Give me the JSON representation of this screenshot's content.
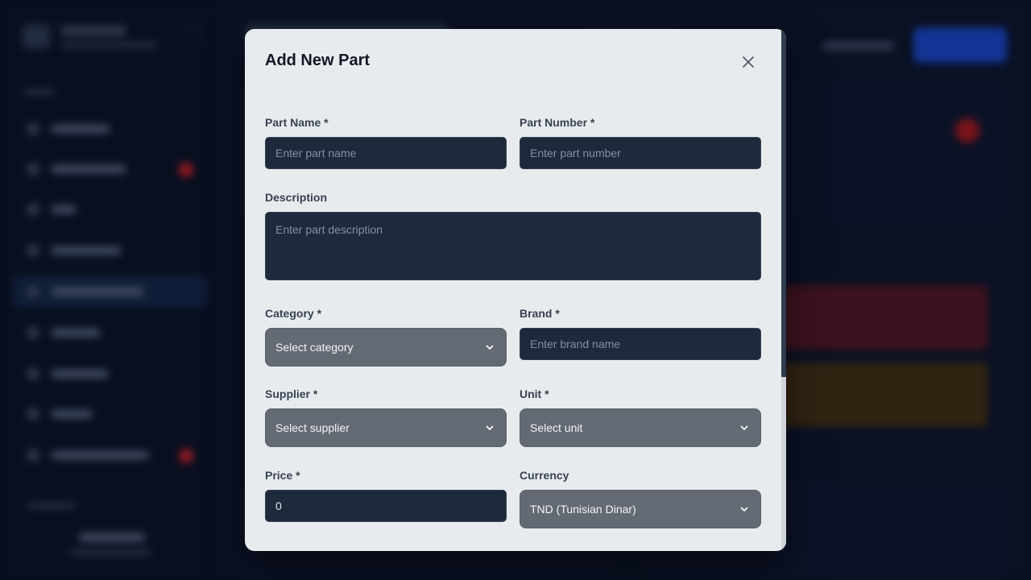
{
  "modal": {
    "title": "Add New Part",
    "close_icon": "close-icon"
  },
  "form": {
    "part_name": {
      "label": "Part Name *",
      "placeholder": "Enter part name"
    },
    "part_number": {
      "label": "Part Number *",
      "placeholder": "Enter part number"
    },
    "description": {
      "label": "Description",
      "placeholder": "Enter part description"
    },
    "category": {
      "label": "Category *",
      "selected": "Select category"
    },
    "brand": {
      "label": "Brand *",
      "placeholder": "Enter brand name"
    },
    "supplier": {
      "label": "Supplier *",
      "selected": "Select supplier"
    },
    "unit": {
      "label": "Unit *",
      "selected": "Select unit"
    },
    "price": {
      "label": "Price *",
      "value": "0"
    },
    "currency": {
      "label": "Currency",
      "selected": "TND (Tunisian Dinar)"
    }
  },
  "colors": {
    "modal_bg": "#e8ebee",
    "input_bg": "#1e293b",
    "select_bg": "#636a73",
    "accent": "#1d4ed8"
  }
}
